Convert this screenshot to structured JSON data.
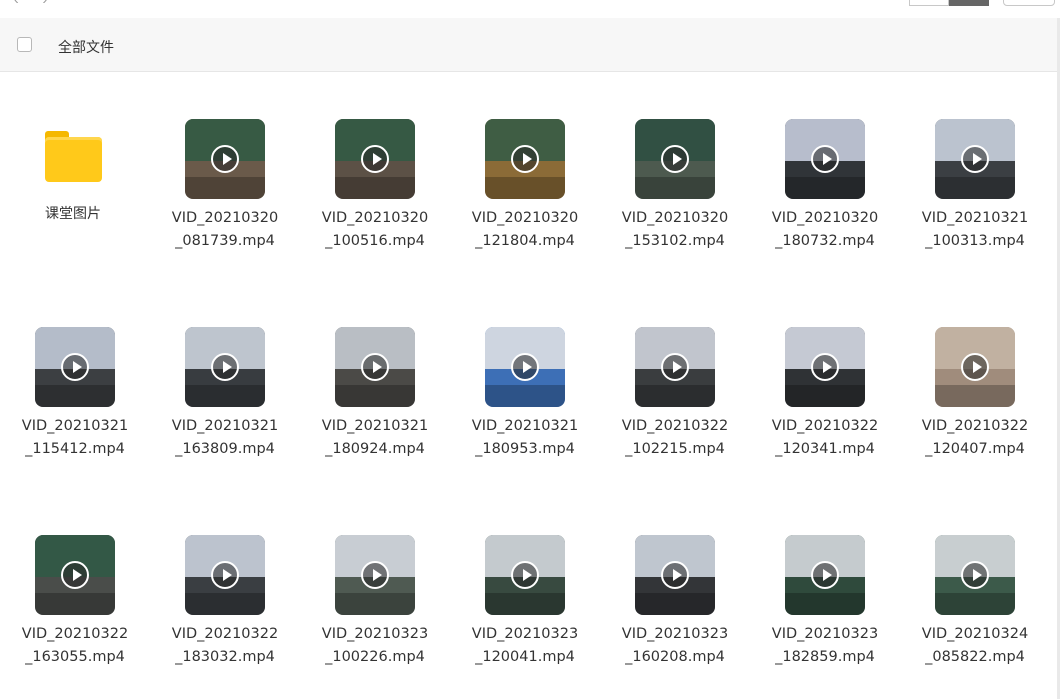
{
  "header": {
    "select_all_label": "全部文件"
  },
  "items": [
    {
      "type": "folder",
      "name": "课堂图片"
    },
    {
      "type": "video",
      "line1": "VID_20210320",
      "line2": "_081739.mp4",
      "bg": "#6a5a4a",
      "accent": "#2e5a43"
    },
    {
      "type": "video",
      "line1": "VID_20210320",
      "line2": "_100516.mp4",
      "bg": "#5c5146",
      "accent": "#2f5b44"
    },
    {
      "type": "video",
      "line1": "VID_20210320",
      "line2": "_121804.mp4",
      "bg": "#8b6b37",
      "accent": "#315a46"
    },
    {
      "type": "video",
      "line1": "VID_20210320",
      "line2": "_153102.mp4",
      "bg": "#4d5a4f",
      "accent": "#2d4f41"
    },
    {
      "type": "video",
      "line1": "VID_20210320",
      "line2": "_180732.mp4",
      "bg": "#303438",
      "accent": "#cfd6e6"
    },
    {
      "type": "video",
      "line1": "VID_20210321",
      "line2": "_100313.mp4",
      "bg": "#3b3f43",
      "accent": "#d2dbe8"
    },
    {
      "type": "video",
      "line1": "VID_20210321",
      "line2": "_115412.mp4",
      "bg": "#3c3f42",
      "accent": "#c9d2e0"
    },
    {
      "type": "video",
      "line1": "VID_20210321",
      "line2": "_163809.mp4",
      "bg": "#383c40",
      "accent": "#d6dde8"
    },
    {
      "type": "video",
      "line1": "VID_20210321",
      "line2": "_180924.mp4",
      "bg": "#4b4a47",
      "accent": "#cdd2db"
    },
    {
      "type": "video",
      "line1": "VID_20210321",
      "line2": "_180953.mp4",
      "bg": "#3d6fb6",
      "accent": "#e8e8e8"
    },
    {
      "type": "video",
      "line1": "VID_20210322",
      "line2": "_102215.mp4",
      "bg": "#3a3d3f",
      "accent": "#d9dde6"
    },
    {
      "type": "video",
      "line1": "VID_20210322",
      "line2": "_120341.mp4",
      "bg": "#2f3235",
      "accent": "#dfe4ee"
    },
    {
      "type": "video",
      "line1": "VID_20210322",
      "line2": "_120407.mp4",
      "bg": "#a08c7c",
      "accent": "#c7b7a8"
    },
    {
      "type": "video",
      "line1": "VID_20210322",
      "line2": "_163055.mp4",
      "bg": "#4a4d4a",
      "accent": "#2f5a45"
    },
    {
      "type": "video",
      "line1": "VID_20210322",
      "line2": "_183032.mp4",
      "bg": "#3a3e42",
      "accent": "#d4dbe6"
    },
    {
      "type": "video",
      "line1": "VID_20210323",
      "line2": "_100226.mp4",
      "bg": "#4f5a52",
      "accent": "#dde2ea"
    },
    {
      "type": "video",
      "line1": "VID_20210323",
      "line2": "_120041.mp4",
      "bg": "#384a40",
      "accent": "#dde1e8"
    },
    {
      "type": "video",
      "line1": "VID_20210323",
      "line2": "_160208.mp4",
      "bg": "#333538",
      "accent": "#d8dfea"
    },
    {
      "type": "video",
      "line1": "VID_20210323",
      "line2": "_182859.mp4",
      "bg": "#2f4a3c",
      "accent": "#dfe2e8"
    },
    {
      "type": "video",
      "line1": "VID_20210324",
      "line2": "_085822.mp4",
      "bg": "#3c5a4a",
      "accent": "#e0e3e8"
    }
  ]
}
